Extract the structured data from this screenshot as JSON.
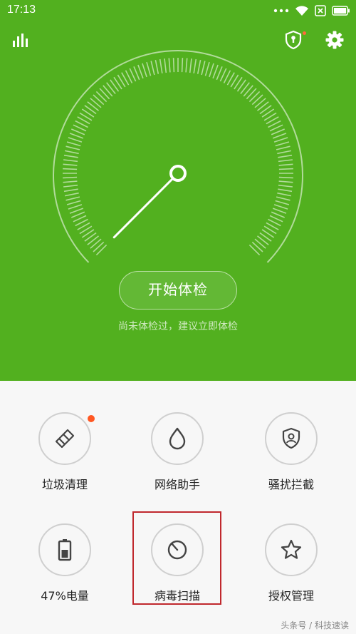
{
  "status_bar": {
    "time": "17:13",
    "icons": [
      "dots-icon",
      "wifi-icon",
      "no-sim-icon",
      "battery-icon"
    ]
  },
  "header": {
    "left_icon": "stats-icon",
    "right_icons": [
      "shield-lock-icon",
      "gear-icon"
    ]
  },
  "gauge": {
    "needle_level": 0.0
  },
  "main": {
    "start_button": "开始体检",
    "hint": "尚未体检过，建议立即体检"
  },
  "tools": [
    {
      "label": "垃圾清理",
      "icon": "brush-icon",
      "badge": true
    },
    {
      "label": "网络助手",
      "icon": "drop-icon"
    },
    {
      "label": "骚扰拦截",
      "icon": "shield-user-icon"
    },
    {
      "label": "47%电量",
      "icon": "battery-icon"
    },
    {
      "label": "病毒扫描",
      "icon": "scan-icon",
      "highlighted": true
    },
    {
      "label": "授权管理",
      "icon": "star-icon"
    }
  ],
  "watermark": "头条号 / 科技速读",
  "colors": {
    "primary_green": "#52b01f",
    "highlight_red": "#c0282d",
    "badge_orange": "#ff5722"
  }
}
